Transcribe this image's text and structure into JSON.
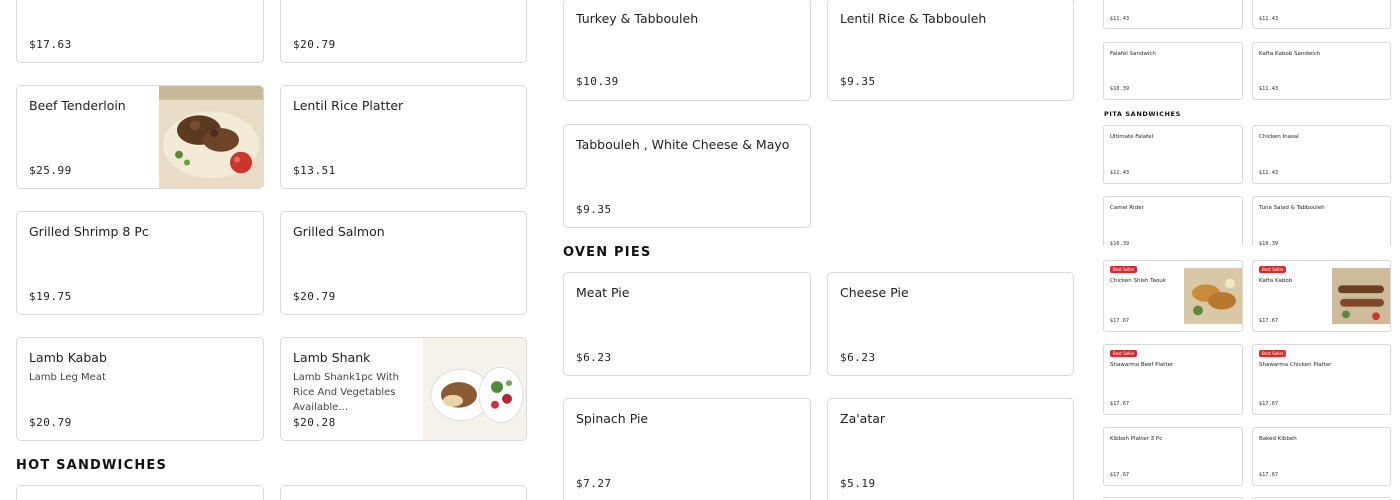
{
  "left_cards": [
    {
      "name": "",
      "price": "$17.63"
    },
    {
      "name": "",
      "price": "$20.79"
    },
    {
      "name": "Beef Tenderloin",
      "price": "$25.99"
    },
    {
      "name": "Lentil Rice Platter",
      "price": "$13.51"
    },
    {
      "name": "Grilled Shrimp 8 Pc",
      "price": "$19.75"
    },
    {
      "name": "Grilled Salmon",
      "price": "$20.79"
    },
    {
      "name": "Lamb Kabab",
      "desc": "Lamb Leg Meat",
      "price": "$20.79"
    },
    {
      "name": "Lamb Shank",
      "desc": "Lamb Shank1pc With Rice And Vegetables Available…",
      "price": "$20.28"
    }
  ],
  "sections": {
    "hot_sandwiches": "Hot Sandwiches",
    "oven_pies": "Oven Pies",
    "pita_sandwiches": "Pita Sandwiches"
  },
  "middle_cards": [
    {
      "name": "Turkey & Tabbouleh",
      "price": "$10.39"
    },
    {
      "name": "Lentil Rice & Tabbouleh",
      "price": "$9.35"
    },
    {
      "name": "Tabbouleh , White Cheese & Mayo",
      "price": "$9.35"
    },
    {
      "name": "Meat Pie",
      "price": "$6.23"
    },
    {
      "name": "Cheese Pie",
      "price": "$6.23"
    },
    {
      "name": "Spinach Pie",
      "price": "$7.27"
    },
    {
      "name": "Za'atar",
      "price": "$5.19"
    }
  ],
  "right_cards": [
    {
      "name": "",
      "price": "$11.43"
    },
    {
      "name": "",
      "price": "$11.43"
    },
    {
      "name": "Falafel Sandwich",
      "price": "$10.39"
    },
    {
      "name": "Kafta Kabob Sandwich",
      "price": "$11.43"
    },
    {
      "name": "Ultimate Falafel",
      "price": "$11.43"
    },
    {
      "name": "Chicken Inasal",
      "price": "$11.43"
    },
    {
      "name": "Camel Rider",
      "price": "$10.39"
    },
    {
      "name": "Tuna Salad & Tabbouleh",
      "price": "$10.39"
    },
    {
      "badge": "Best Seller",
      "name": "Chicken Shish Taouk",
      "price": "$17.67"
    },
    {
      "badge": "Best Seller",
      "name": "Kafta Kabob",
      "price": "$17.67"
    },
    {
      "badge": "Best Seller",
      "name": "Shawarma Beef Platter",
      "price": "$17.67"
    },
    {
      "badge": "Best Seller",
      "name": "Shawarma Chicken Platter",
      "price": "$17.67"
    },
    {
      "name": "Kibbeh Platter 3 Pc",
      "price": "$17.67"
    },
    {
      "name": "Baked Kibbeh",
      "price": "$17.67"
    }
  ]
}
